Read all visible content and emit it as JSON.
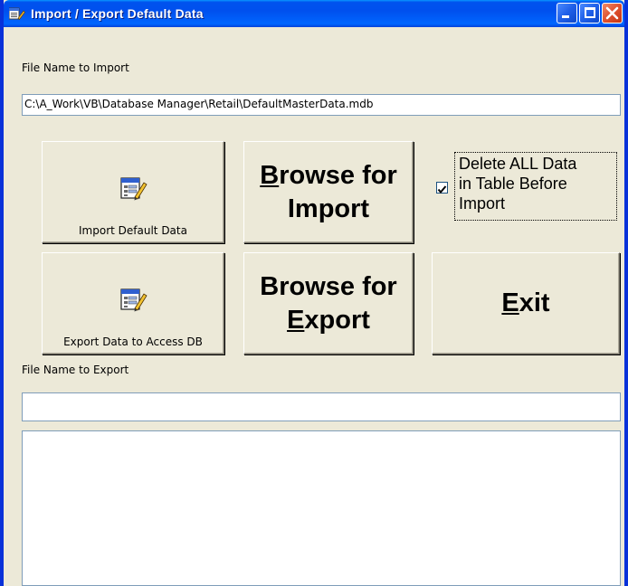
{
  "window": {
    "title": "Import / Export Default Data"
  },
  "import": {
    "label": "File Name to Import",
    "path": "C:\\A_Work\\VB\\Database Manager\\Retail\\DefaultMasterData.mdb"
  },
  "buttons": {
    "import_default": "Import Default Data",
    "browse_import_l1_accel": "B",
    "browse_import_l1_rest": "rowse for",
    "browse_import_l2": "Import",
    "export_access": "Export Data to Access DB",
    "browse_export_l1": "Browse for",
    "browse_export_l2_accel": "E",
    "browse_export_l2_rest": "xport",
    "exit_accel": "E",
    "exit_rest": "xit"
  },
  "delete_option": {
    "line1": "Delete ALL Data",
    "line2": "in Table Before",
    "line3": "Import",
    "checked": true
  },
  "export": {
    "label": "File Name to Export",
    "path": ""
  },
  "log": {
    "text": ""
  },
  "icons": {
    "app": "data-form-icon",
    "import": "form-edit-icon",
    "export": "form-edit-icon"
  }
}
